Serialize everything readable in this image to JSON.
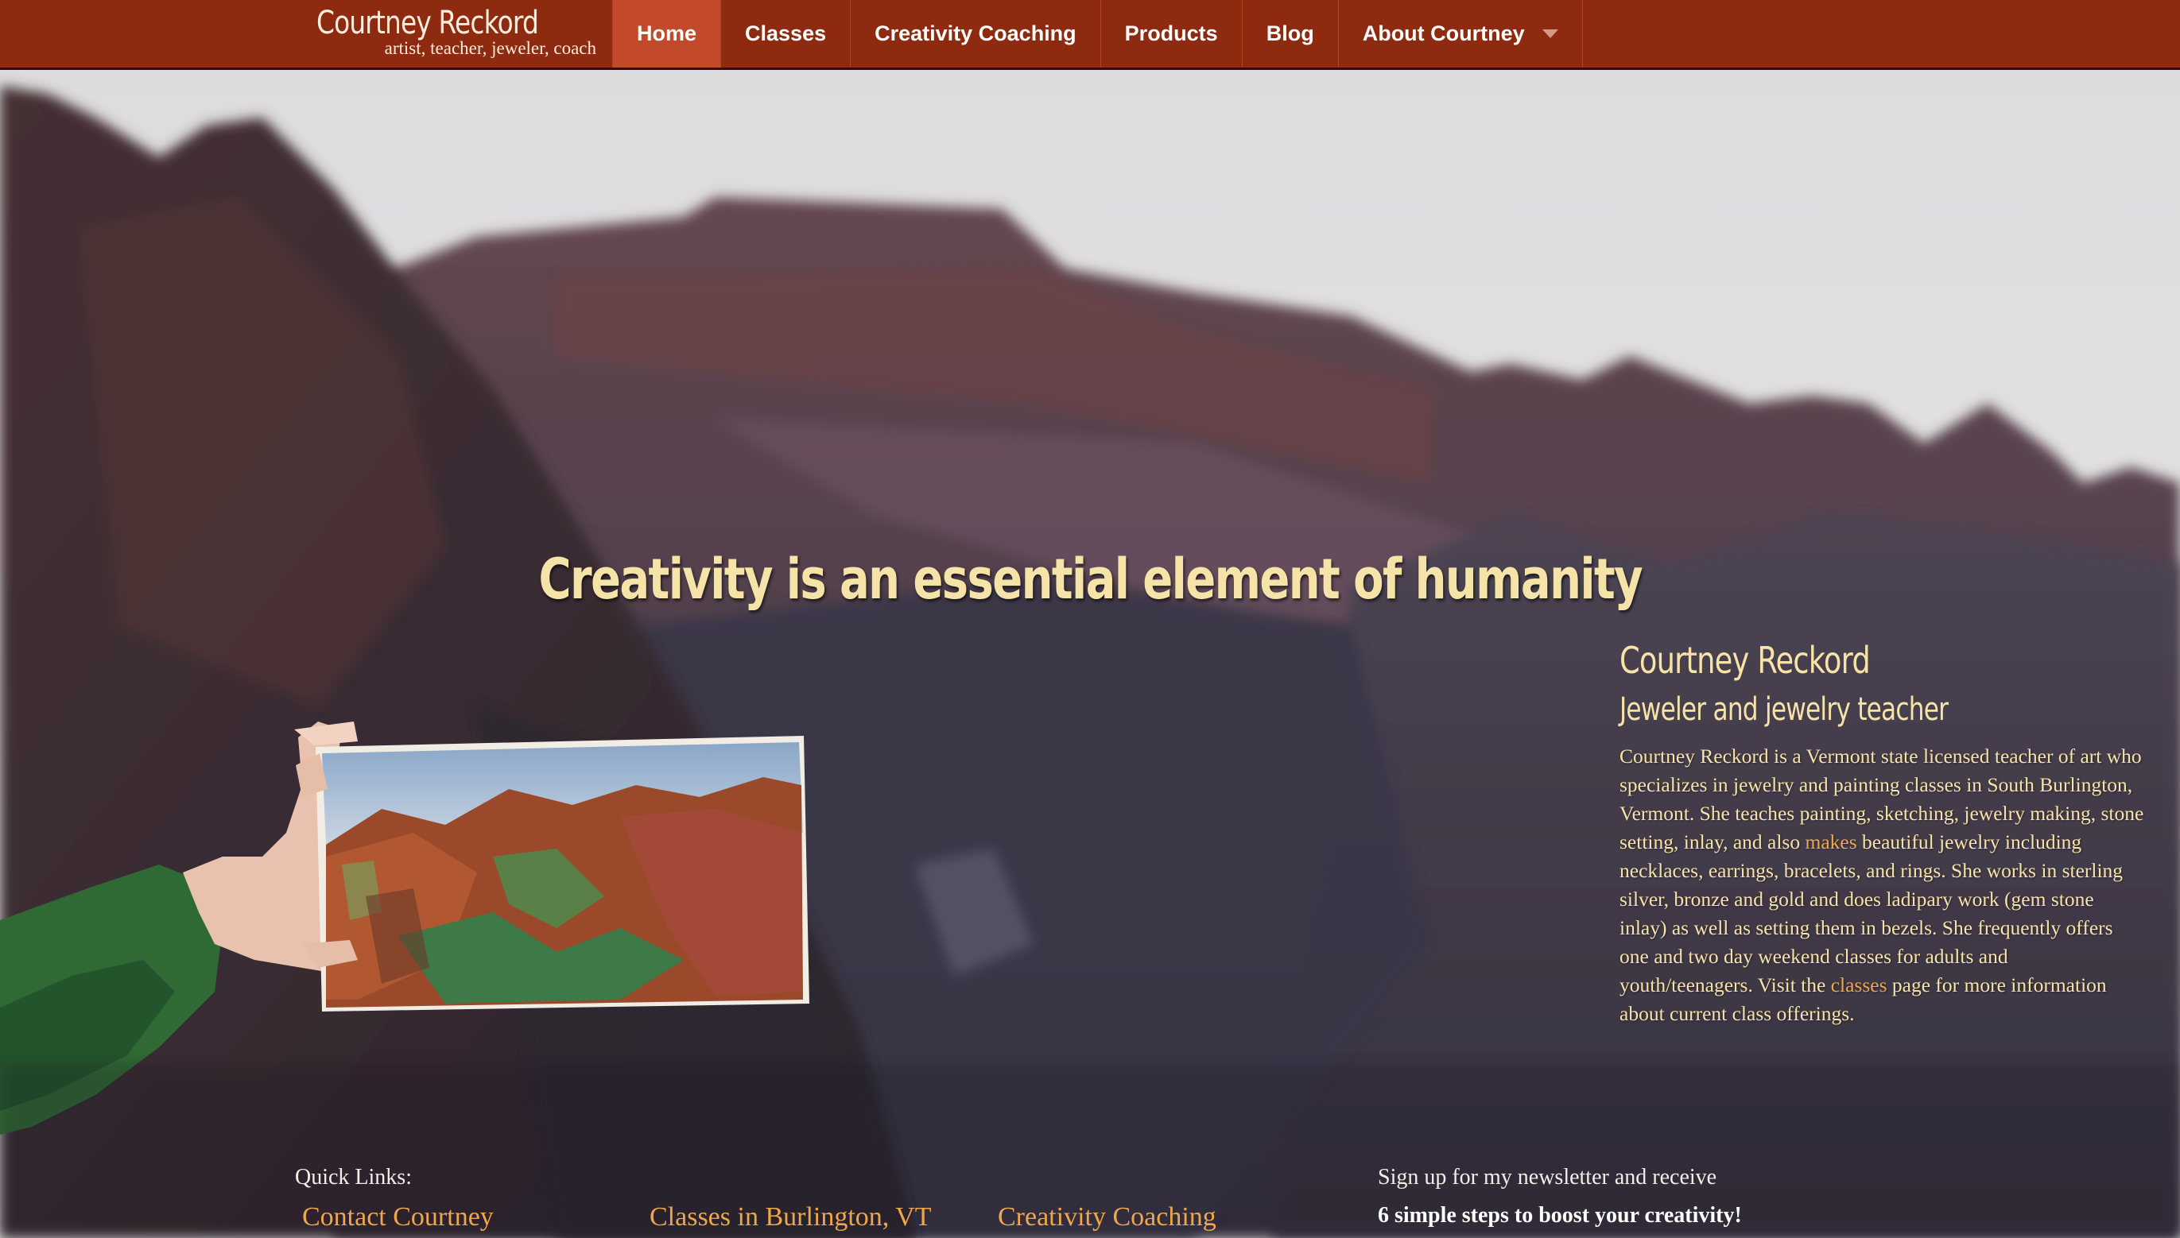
{
  "brand": {
    "name": "Courtney Reckord",
    "tagline": "artist, teacher, jeweler, coach"
  },
  "nav": {
    "items": [
      {
        "label": "Home",
        "active": true
      },
      {
        "label": "Classes"
      },
      {
        "label": "Creativity Coaching"
      },
      {
        "label": "Products"
      },
      {
        "label": "Blog"
      },
      {
        "label": "About Courtney",
        "has_dropdown": true
      }
    ]
  },
  "hero": {
    "tagline": "Creativity is an essential element of humanity"
  },
  "bio": {
    "name": "Courtney Reckord",
    "role": "Jeweler and jewelry teacher",
    "text_1": "Courtney Reckord is a Vermont state licensed teacher of art who specializes in jewelry and painting classes in South Burlington, Vermont. She teaches painting, sketching, jewelry making, stone setting, inlay, and also ",
    "link_makes": "makes",
    "text_2": " beautiful jewelry including necklaces, earrings, bracelets, and rings. She works in sterling silver, bronze and gold and does ladipary work (gem stone inlay) as well as setting them in bezels. She frequently offers one and two day weekend classes for adults and youth/teenagers. Visit the ",
    "link_classes": "classes",
    "text_3": " page for more information about current class offerings."
  },
  "footer": {
    "quick_links_title": "Quick Links:",
    "quick_links": [
      "Contact Courtney",
      "Classes in Burlington, VT",
      "Creativity Coaching"
    ],
    "newsletter_title": "Sign up for my newsletter and receive",
    "newsletter_sub": "6 simple steps to boost your creativity!"
  },
  "colors": {
    "nav_bg": "#8d2a10",
    "nav_active": "#c24a2a",
    "headline": "#f6e3a8",
    "link": "#f0a64b"
  }
}
